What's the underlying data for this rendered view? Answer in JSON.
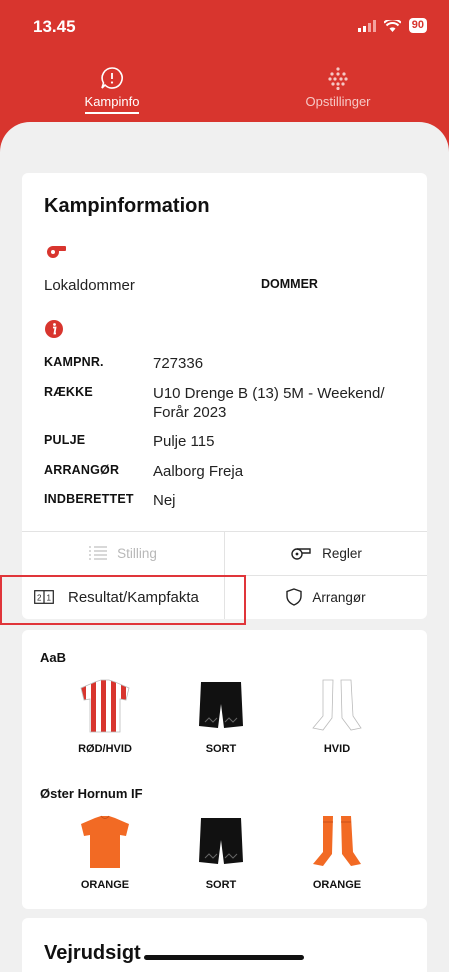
{
  "status_bar": {
    "time": "13.45",
    "battery": "90"
  },
  "tabs": [
    {
      "label": "Kampinfo",
      "icon": "info-bubble-icon",
      "active": true
    },
    {
      "label": "Opstillinger",
      "icon": "formation-dots-icon",
      "active": false
    }
  ],
  "match_info": {
    "title": "Kampinformation",
    "referee_icon": "whistle-icon",
    "referee_name": "Lokaldommer",
    "referee_role": "DOMMER",
    "info_icon": "info-icon",
    "rows": [
      {
        "label": "KAMPNR.",
        "value": "727336"
      },
      {
        "label": "RÆKKE",
        "value": "U10 Drenge B (13) 5M - Weekend/ Forår 2023"
      },
      {
        "label": "PULJE",
        "value": "Pulje 115"
      },
      {
        "label": "ARRANGØR",
        "value": "Aalborg Freja"
      },
      {
        "label": "INDBERETTET",
        "value": "Nej"
      }
    ],
    "buttons": {
      "standings": "Stilling",
      "rules": "Regler",
      "result": "Resultat/Kampfakta",
      "organizer": "Arrangør"
    }
  },
  "kits": {
    "home": {
      "team": "AaB",
      "items": [
        {
          "type": "shirt",
          "label": "RØD/HVID"
        },
        {
          "type": "shorts",
          "label": "SORT"
        },
        {
          "type": "socks",
          "label": "HVID"
        }
      ]
    },
    "away": {
      "team": "Øster Hornum IF",
      "items": [
        {
          "type": "shirt",
          "label": "ORANGE"
        },
        {
          "type": "shorts",
          "label": "SORT"
        },
        {
          "type": "socks",
          "label": "ORANGE"
        }
      ]
    }
  },
  "weather": {
    "title": "Vejrudsigt"
  },
  "colors": {
    "brand_red": "#d8352e",
    "orange": "#f26a24",
    "highlight": "#e0353a"
  }
}
